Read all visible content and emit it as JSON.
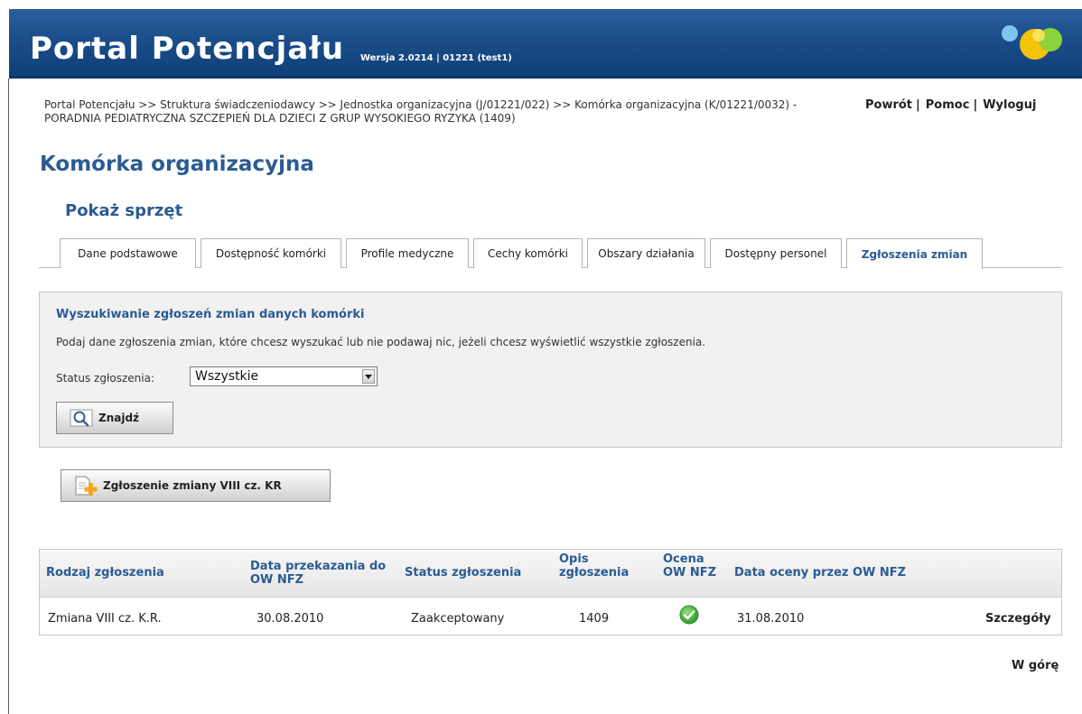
{
  "header": {
    "app_title": "Portal Potencjału",
    "version": "Wersja 2.0214 | 01221 (test1)"
  },
  "breadcrumb": "Portal Potencjału >> Struktura świadczeniodawcy >> Jednostka organizacyjna (J/01221/022) >> Komórka organizacyjna (K/01221/0032) - PORADNIA PEDIATRYCZNA SZCZEPIEŃ DLA DZIECI Z GRUP WYSOKIEGO RYZYKA (1409)",
  "top_links": {
    "back": "Powrót",
    "help": "Pomoc",
    "logout": "Wyloguj",
    "separator": "|"
  },
  "page_title": "Komórka organizacyjna",
  "section_title": "Pokaż sprzęt",
  "tabs": [
    {
      "label": "Dane podstawowe"
    },
    {
      "label": "Dostępność komórki"
    },
    {
      "label": "Profile medyczne"
    },
    {
      "label": "Cechy komórki"
    },
    {
      "label": "Obszary działania"
    },
    {
      "label": "Dostępny personel"
    },
    {
      "label": "Zgłoszenia zmian",
      "active": true
    }
  ],
  "search": {
    "title": "Wyszukiwanie zgłoszeń zmian danych komórki",
    "description": "Podaj dane zgłoszenia zmian, które chcesz wyszukać lub nie podawaj nic, jeżeli chcesz wyświetlić wszystkie zgłoszenia.",
    "status_label": "Status zgłoszenia:",
    "status_value": "Wszystkie",
    "find_button": "Znajdź"
  },
  "change_button": "Zgłoszenie zmiany VIII cz. KR",
  "table": {
    "headers": {
      "type": "Rodzaj zgłoszenia",
      "date_sent_1": "Data przekazania do",
      "date_sent_2": "OW NFZ",
      "status": "Status zgłoszenia",
      "desc_1": "Opis",
      "desc_2": "zgłoszenia",
      "rating_1": "Ocena",
      "rating_2": "OW NFZ",
      "rating_date": "Data oceny przez OW NFZ"
    },
    "rows": [
      {
        "type": "Zmiana VIII cz. K.R.",
        "date_sent": "30.08.2010",
        "status": "Zaakceptowany",
        "description": "1409",
        "rating": "ok-check-icon",
        "rating_date": "31.08.2010",
        "details": "Szczegóły"
      }
    ]
  },
  "to_top": "W górę",
  "colors": {
    "banner": "#1a4d89",
    "heading": "#2b5b93",
    "panel": "#f1f1f1",
    "ok": "#3fa93a"
  }
}
